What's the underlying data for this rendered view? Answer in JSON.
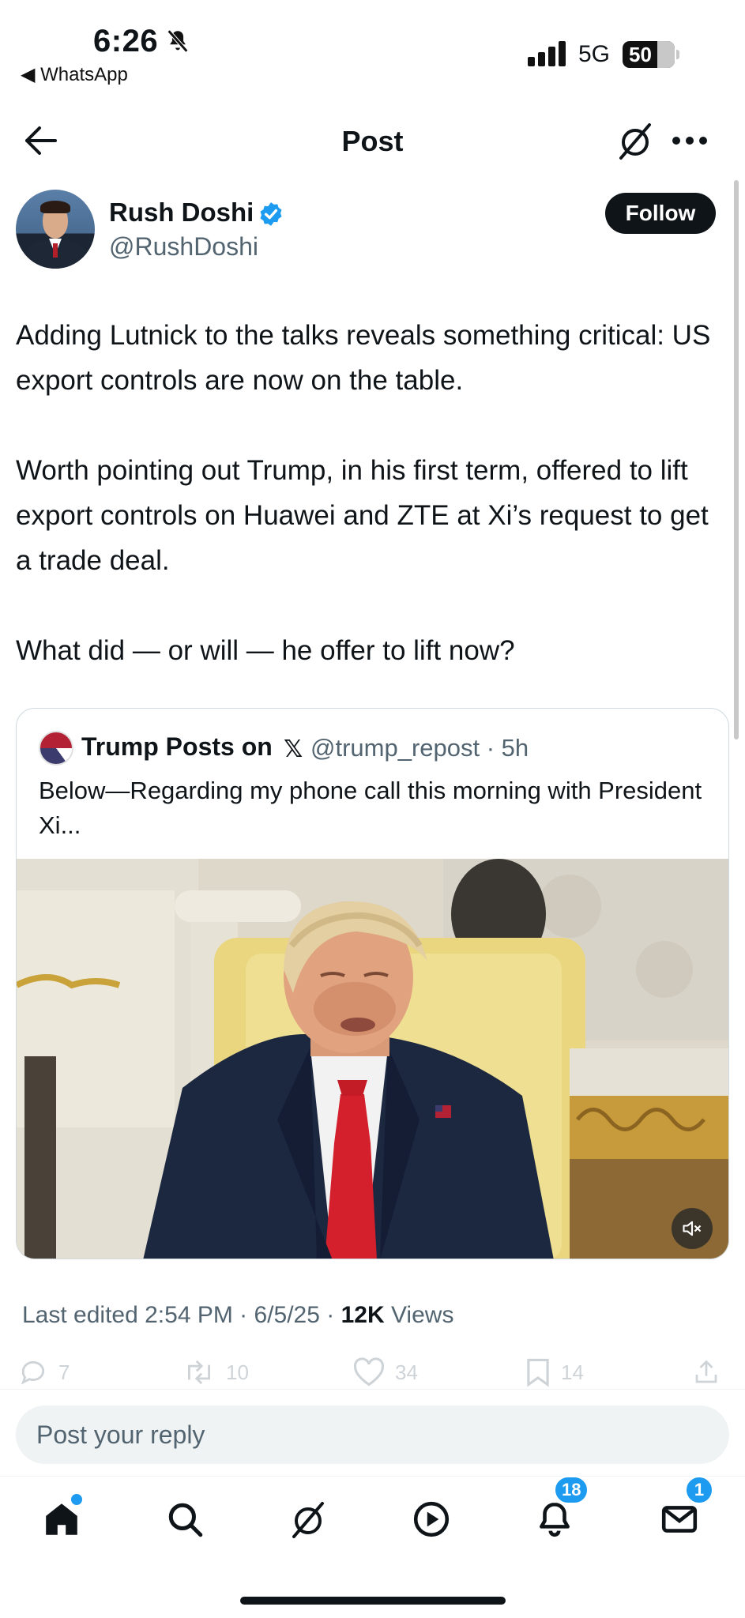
{
  "status_bar": {
    "time": "6:26",
    "back_app": "◀ WhatsApp",
    "network": "5G",
    "battery": "50"
  },
  "header": {
    "title": "Post"
  },
  "author": {
    "name": "Rush Doshi",
    "handle": "@RushDoshi",
    "follow_label": "Follow"
  },
  "post": {
    "paragraphs": [
      "Adding Lutnick to the talks reveals something critical: US export controls are now on the table.",
      "Worth pointing out Trump, in his first term, offered to lift export controls on Huawei and ZTE at Xi’s request to get a trade deal.",
      "What did — or will — he offer to lift now?"
    ]
  },
  "quote": {
    "name": "Trump Posts on",
    "x_glyph": "𝕏",
    "handle_time": "@trump_repost · 5h",
    "text": "Below—Regarding my phone call this morning with President Xi..."
  },
  "meta": {
    "edited": "Last edited 2:54 PM · 6/5/25 ·",
    "views_count": "12K",
    "views_label": "Views"
  },
  "actions": {
    "replies": "7",
    "reposts": "10",
    "likes": "34",
    "bookmarks": "14"
  },
  "reply": {
    "placeholder": "Post your reply"
  },
  "nav": {
    "notifications_badge": "18",
    "messages_badge": "1"
  },
  "colors": {
    "accent": "#1d9bf0",
    "text": "#0f1419",
    "secondary": "#536471"
  }
}
